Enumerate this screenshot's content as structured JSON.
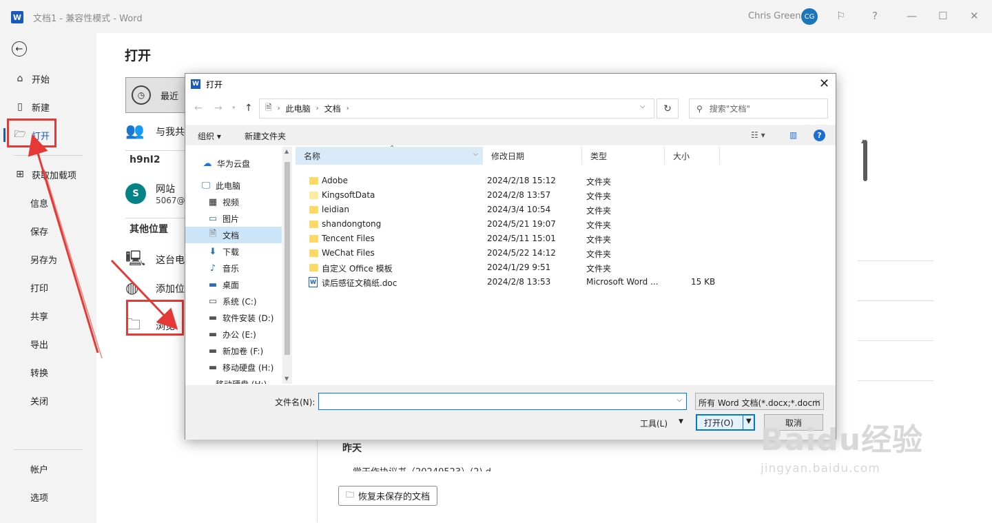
{
  "titlebar": {
    "app_logo": "W",
    "doc_title": "文档1 - 兼容性模式 - Word",
    "user_name": "Chris Green",
    "user_initials": "CG",
    "icons": [
      "feedback-icon",
      "help-icon",
      "minimize-icon",
      "maximize-icon",
      "close-icon"
    ]
  },
  "sidebar": {
    "back_icon": "←",
    "items": [
      {
        "label": "开始",
        "icon": "home-icon"
      },
      {
        "label": "新建",
        "icon": "new-doc-icon"
      },
      {
        "label": "打开",
        "icon": "folder-open-icon"
      },
      {
        "label": "获取加载项",
        "icon": "addins-icon"
      },
      {
        "label": "信息"
      },
      {
        "label": "保存"
      },
      {
        "label": "另存为"
      },
      {
        "label": "打印"
      },
      {
        "label": "共享"
      },
      {
        "label": "导出"
      },
      {
        "label": "转换"
      },
      {
        "label": "关闭"
      },
      {
        "label": "帐户"
      },
      {
        "label": "选项"
      }
    ]
  },
  "main": {
    "title": "打开",
    "recent_label": "最近",
    "shared_label": "与我共",
    "account_heading": "h9nI2",
    "site_label": "网站",
    "site_sub": "5067@",
    "other_heading": "其他位置",
    "this_pc_label": "这台电",
    "add_place_label": "添加位",
    "browse_label": "浏览",
    "yesterday_heading": "昨天",
    "partial_file": "党干作协议书（20240523）(2).d",
    "recover_button": "恢复未保存的文档"
  },
  "dialog": {
    "title": "打开",
    "close_icon": "✕",
    "breadcrumb": [
      "此电脑",
      "文档"
    ],
    "search_placeholder": "搜索\"文档\"",
    "organize_label": "组织 ▾",
    "new_folder_label": "新建文件夹",
    "tree": [
      {
        "label": "华为云盘",
        "icon": "cloud-icon"
      },
      {
        "label": "此电脑",
        "icon": "pc-icon"
      },
      {
        "label": "视频",
        "icon": "video-icon"
      },
      {
        "label": "图片",
        "icon": "picture-icon"
      },
      {
        "label": "文档",
        "icon": "document-icon",
        "selected": true
      },
      {
        "label": "下载",
        "icon": "download-icon"
      },
      {
        "label": "音乐",
        "icon": "music-icon"
      },
      {
        "label": "桌面",
        "icon": "desktop-icon"
      },
      {
        "label": "系统 (C:)",
        "icon": "drive-icon"
      },
      {
        "label": "软件安装 (D:)",
        "icon": "drive-icon"
      },
      {
        "label": "办公 (E:)",
        "icon": "drive-icon"
      },
      {
        "label": "新加卷 (F:)",
        "icon": "drive-icon"
      },
      {
        "label": "移动硬盘 (H:)",
        "icon": "drive-icon"
      },
      {
        "label": "移动硬盘 (H:)",
        "icon": "drive-icon"
      }
    ],
    "columns": {
      "name": "名称",
      "modified": "修改日期",
      "type": "类型",
      "size": "大小"
    },
    "files": [
      {
        "name": "Adobe",
        "modified": "2024/2/18 15:12",
        "type": "文件夹",
        "size": "",
        "kind": "folder"
      },
      {
        "name": "KingsoftData",
        "modified": "2024/2/8 13:57",
        "type": "文件夹",
        "size": "",
        "kind": "folder-light"
      },
      {
        "name": "leidian",
        "modified": "2024/3/4 10:54",
        "type": "文件夹",
        "size": "",
        "kind": "folder"
      },
      {
        "name": "shandongtong",
        "modified": "2024/5/21 19:07",
        "type": "文件夹",
        "size": "",
        "kind": "folder"
      },
      {
        "name": "Tencent Files",
        "modified": "2024/5/11 15:01",
        "type": "文件夹",
        "size": "",
        "kind": "folder"
      },
      {
        "name": "WeChat Files",
        "modified": "2024/5/22 14:12",
        "type": "文件夹",
        "size": "",
        "kind": "folder"
      },
      {
        "name": "自定义 Office 模板",
        "modified": "2024/1/29 9:51",
        "type": "文件夹",
        "size": "",
        "kind": "folder"
      },
      {
        "name": "读后感征文稿纸.doc",
        "modified": "2024/2/8 13:53",
        "type": "Microsoft Word ...",
        "size": "15 KB",
        "kind": "doc"
      }
    ],
    "filename_label": "文件名(N):",
    "filename_value": "",
    "filetype_value": "所有 Word 文档(*.docx;*.docm",
    "tools_label": "工具(L)",
    "open_label": "打开(O)",
    "cancel_label": "取消"
  },
  "watermark": {
    "main": "Baidu经验",
    "sub": "jingyan.baidu.com"
  }
}
